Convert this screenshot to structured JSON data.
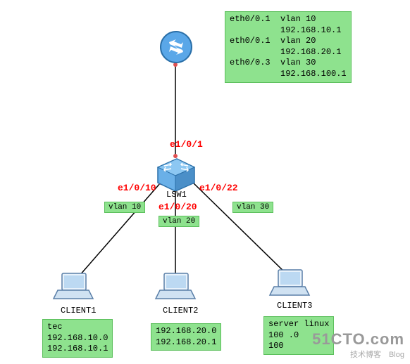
{
  "router": {
    "config_text": "eth0/0.1  vlan 10\n          192.168.10.1\neth0/0.1  vlan 20\n          192.168.20.1\neth0/0.3  vlan 30\n          192.168.100.1"
  },
  "switch": {
    "label": "LSW1",
    "ports": {
      "up": "e1/0/1",
      "left": "e1/0/10",
      "mid": "e1/0/20",
      "right": "e1/0/22"
    }
  },
  "vlans": {
    "left": "vlan 10",
    "mid": "vlan 20",
    "right": "vlan 30"
  },
  "clients": {
    "c1": {
      "label": "CLIENT1",
      "info": "tec\n192.168.10.0\n192.168.10.1"
    },
    "c2": {
      "label": "CLIENT2",
      "info": "192.168.20.0\n192.168.20.1"
    },
    "c3": {
      "label": "CLIENT3",
      "info": "server linux\n100 .0\n100"
    }
  },
  "watermark": {
    "main": "51CTO.com",
    "sub": "技术博客　Blog"
  }
}
